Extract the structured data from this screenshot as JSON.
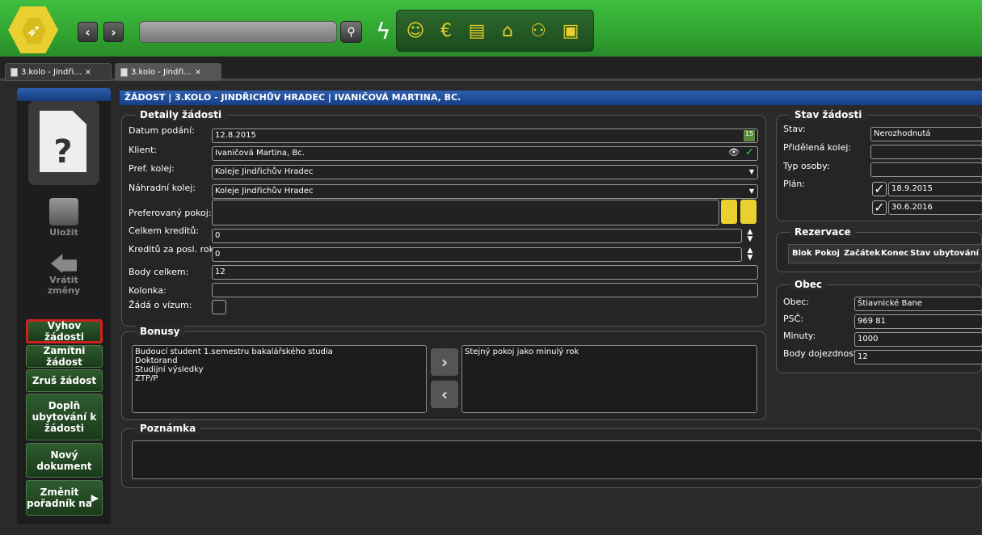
{
  "topbar": {
    "back_label": "‹",
    "forward_label": "›",
    "search_placeholder": "",
    "search_icon": "magnifier-icon",
    "module_icons": [
      "person-icon",
      "money-icon",
      "list-icon",
      "building-icon",
      "people-ab-icon",
      "monitor-icon"
    ]
  },
  "tabs": [
    {
      "label": "3.kolo - Jindři...",
      "close": "×"
    },
    {
      "label": "3.kolo - Jindři...",
      "close": "×"
    }
  ],
  "sidebar": {
    "save_label": "Uložit",
    "revert_label_1": "Vrátit",
    "revert_label_2": "změny",
    "buttons": [
      {
        "label": "Vyhov žádosti"
      },
      {
        "label": "Zamítni žádost"
      },
      {
        "label": "Zruš žádost"
      },
      {
        "label": "Doplň ubytování k žádosti"
      },
      {
        "label": "Nový dokument"
      },
      {
        "label": "Změnit pořadník na"
      }
    ]
  },
  "main": {
    "title": "ŽÁDOST | 3.KOLO - JINDŘICHŮV HRADEC | IVANIČOVÁ MARTINA, BC.",
    "details": {
      "title": "Detaily žádosti",
      "date_label": "Datum podání:",
      "date_value": "12.8.2015",
      "client_label": "Klient:",
      "client_value": "Ivaničová Martina, Bc.",
      "pref_label": "Pref. kolej:",
      "pref_value": "Koleje Jindřichův Hradec",
      "alt_label": "Náhradní kolej:",
      "alt_value": "Koleje Jindřichův Hradec",
      "room_label": "Preferovaný pokoj:",
      "room_value": "",
      "credits_label": "Celkem kreditů:",
      "credits_value": "0",
      "credits_last_label": "Kreditů za posl. rok:",
      "credits_last_value": "0",
      "points_label": "Body celkem:",
      "points_value": "12",
      "column_label": "Kolonka:",
      "column_value": "",
      "visa_label": "Žádá o vízum:"
    },
    "status": {
      "title": "Stav žádosti",
      "state_label": "Stav:",
      "state_value": "Nerozhodnutá",
      "assigned_label": "Přidělená kolej:",
      "assigned_value": "",
      "person_type_label": "Typ osoby:",
      "person_type_value": "",
      "plan_label": "Plán:",
      "plan_from": "18.9.2015",
      "plan_to": "30.6.2016"
    },
    "reservation": {
      "title": "Rezervace",
      "columns": [
        "Blok",
        "Pokoj",
        "Začátek",
        "Konec",
        "Stav ubytování"
      ]
    },
    "municipality": {
      "title": "Obec",
      "obec_label": "Obec:",
      "obec_value": "Štiavnické Bane",
      "psc_label": "PSČ:",
      "psc_value": "969 81",
      "minutes_label": "Minuty:",
      "minutes_value": "1000",
      "commute_label": "Body dojezdnost:",
      "commute_value": "12"
    },
    "bonuses": {
      "title": "Bonusy",
      "available": [
        "Budoucí student 1.semestru bakalářského studia",
        "Doktorand",
        "Studijní výsledky",
        "ZTP/P"
      ],
      "selected": [
        "Stejný pokoj jako minulý rok"
      ]
    },
    "note": {
      "title": "Poznámka",
      "value": ""
    }
  },
  "colors": {
    "topbar_green": "#3fbf3f",
    "title_blue": "#2e5fae",
    "highlight_red": "#d12020"
  }
}
